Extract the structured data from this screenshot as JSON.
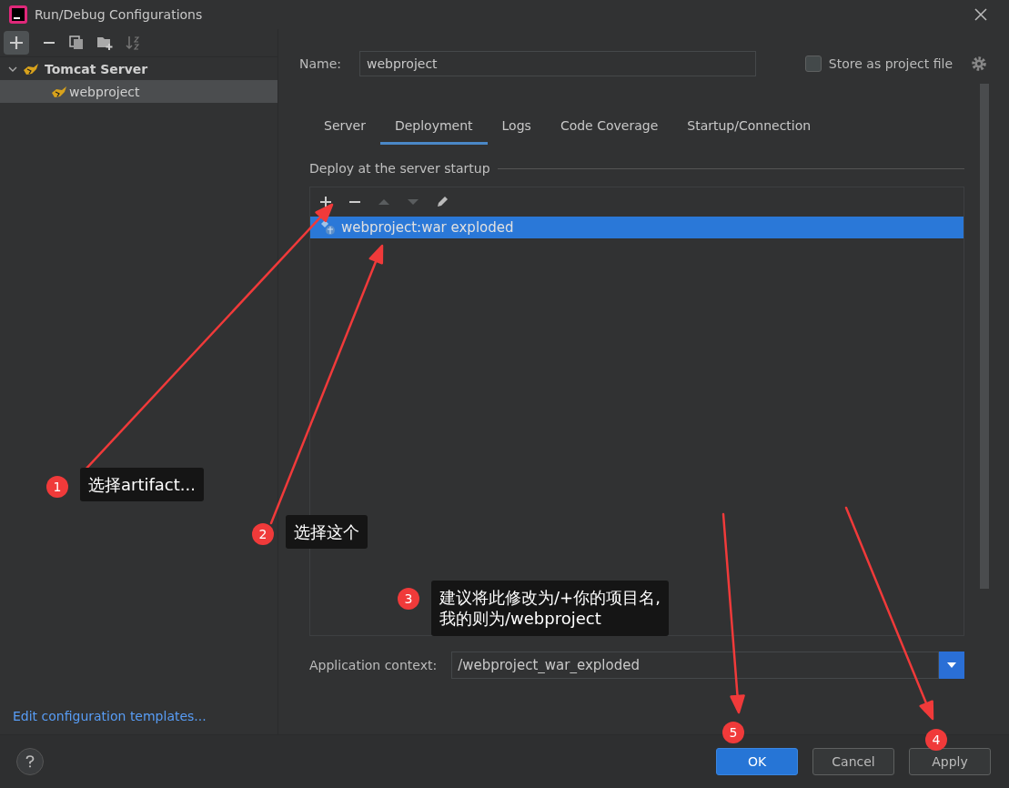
{
  "window": {
    "title": "Run/Debug Configurations"
  },
  "sidebar": {
    "tree": [
      {
        "label": "Tomcat Server",
        "expanded": true,
        "selected": false,
        "children": [
          {
            "label": "webproject",
            "selected": true
          }
        ]
      }
    ],
    "link": "Edit configuration templates..."
  },
  "form": {
    "name_label": "Name:",
    "name_value": "webproject",
    "store": {
      "label": "Store as project file",
      "checked": false
    }
  },
  "tabs": [
    {
      "label": "Server",
      "selected": false
    },
    {
      "label": "Deployment",
      "selected": true
    },
    {
      "label": "Logs",
      "selected": false
    },
    {
      "label": "Code Coverage",
      "selected": false
    },
    {
      "label": "Startup/Connection",
      "selected": false
    }
  ],
  "deploy": {
    "title": "Deploy at the server startup",
    "items": [
      {
        "label": "webproject:war exploded",
        "selected": true
      }
    ]
  },
  "context": {
    "label": "Application context:",
    "value": "/webproject_war_exploded"
  },
  "buttons": [
    {
      "label": "OK",
      "kind": "primary"
    },
    {
      "label": "Cancel",
      "kind": "plain"
    },
    {
      "label": "Apply",
      "kind": "plain"
    }
  ],
  "annotations": [
    {
      "number": "1",
      "text": "选择artifact..."
    },
    {
      "number": "2",
      "text": "选择这个"
    },
    {
      "number": "3",
      "text": "建议将此修改为/+你的项目名,\n我的则为/webproject"
    },
    {
      "number": "5"
    },
    {
      "number": "4"
    }
  ]
}
